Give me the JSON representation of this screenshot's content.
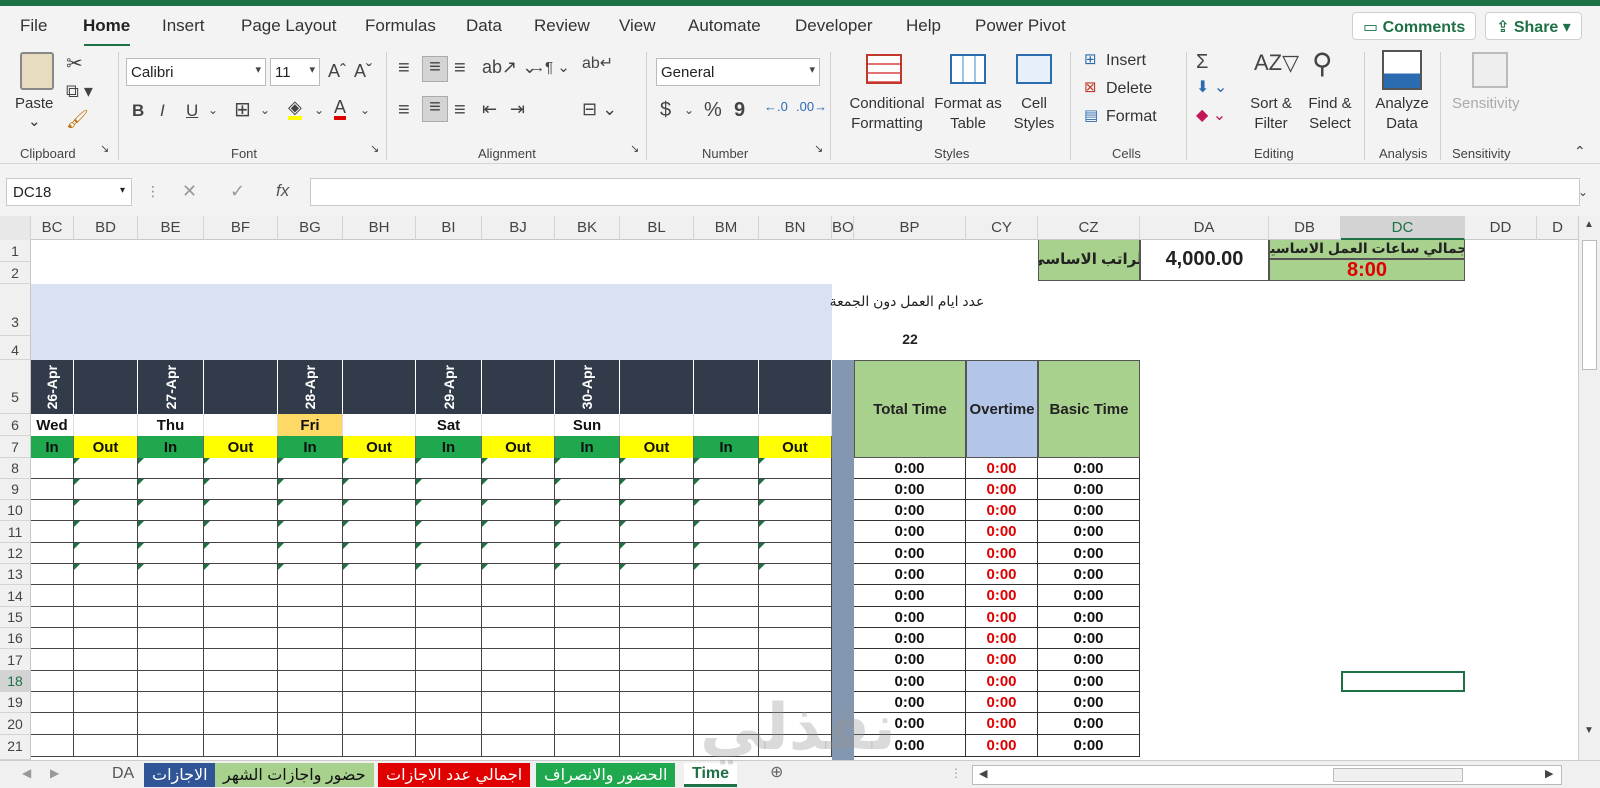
{
  "tabs": [
    "File",
    "Home",
    "Insert",
    "Page Layout",
    "Formulas",
    "Data",
    "Review",
    "View",
    "Automate",
    "Developer",
    "Help",
    "Power Pivot"
  ],
  "top_buttons": {
    "comments": "Comments",
    "share": "Share"
  },
  "ribbon": {
    "clipboard": {
      "paste": "Paste",
      "group": "Clipboard"
    },
    "font": {
      "name": "Calibri",
      "size": "11",
      "bold": "B",
      "italic": "I",
      "underline": "U",
      "grow": "A^",
      "shrink": "Aˇ",
      "color_letter": "A",
      "group": "Font"
    },
    "alignment": {
      "group": "Alignment"
    },
    "number": {
      "format": "General",
      "currency": "$",
      "percent": "%",
      "comma": "9",
      "group": "Number"
    },
    "styles": {
      "conditional": "Conditional Formatting",
      "format_as_table": "Format as Table",
      "cell_styles": "Cell Styles",
      "group": "Styles"
    },
    "cells": {
      "insert": "Insert",
      "delete": "Delete",
      "format": "Format",
      "group": "Cells"
    },
    "editing": {
      "sum": "Σ",
      "sort": "Sort & Filter",
      "find": "Find & Select",
      "group": "Editing"
    },
    "analysis": {
      "analyze": "Analyze Data",
      "group": "Analysis"
    },
    "sensitivity": {
      "label": "Sensitivity",
      "group": "Sensitivity"
    }
  },
  "namebox": "DC18",
  "fx": "fx",
  "columns": [
    "BC",
    "BD",
    "BE",
    "BF",
    "BG",
    "BH",
    "BI",
    "BJ",
    "BK",
    "BL",
    "BM",
    "BN",
    "BO",
    "BP",
    "CY",
    "CZ",
    "DA",
    "DB",
    "DC",
    "DD",
    "D"
  ],
  "rows": [
    "1",
    "2",
    "3",
    "4",
    "5",
    "6",
    "7",
    "8",
    "9",
    "10",
    "11",
    "12",
    "13",
    "14",
    "15",
    "16",
    "17",
    "18",
    "19",
    "20",
    "21"
  ],
  "sheet": {
    "basic_salary_label": "الراتب الاساسي",
    "basic_salary_value": "4,000.00",
    "total_hours_label": "اجمالي ساعات العمل الاساسية",
    "total_hours_value": "8:00",
    "workdays_label": "عدد ايام العمل دون الجمعة",
    "workdays_value": "22",
    "dates": [
      "26-Apr",
      "27-Apr",
      "28-Apr",
      "29-Apr",
      "30-Apr"
    ],
    "days": [
      "Wed",
      "Thu",
      "Fri",
      "Sat",
      "Sun"
    ],
    "in_label": "In",
    "out_label": "Out",
    "total_time_header": "Total Time",
    "overtime_header": "Overtime",
    "basic_time_header": "Basic Time",
    "zero_time": "0:00"
  },
  "sheet_tabs": [
    "DA",
    "الاجازات",
    "حضور واجازات الشهر",
    "اجمالي عدد الاجازات",
    "الحضور والانصراف",
    "Time"
  ],
  "colors": {
    "accent": "#1e7145",
    "date_header": "#323b49",
    "in": "#1fa84e",
    "out": "#ffff00",
    "fri": "#ffd966",
    "summary": "#a9d18e",
    "overtime": "#b4c6e7",
    "band": "#d9e1f2"
  },
  "watermark": "نفذلي"
}
